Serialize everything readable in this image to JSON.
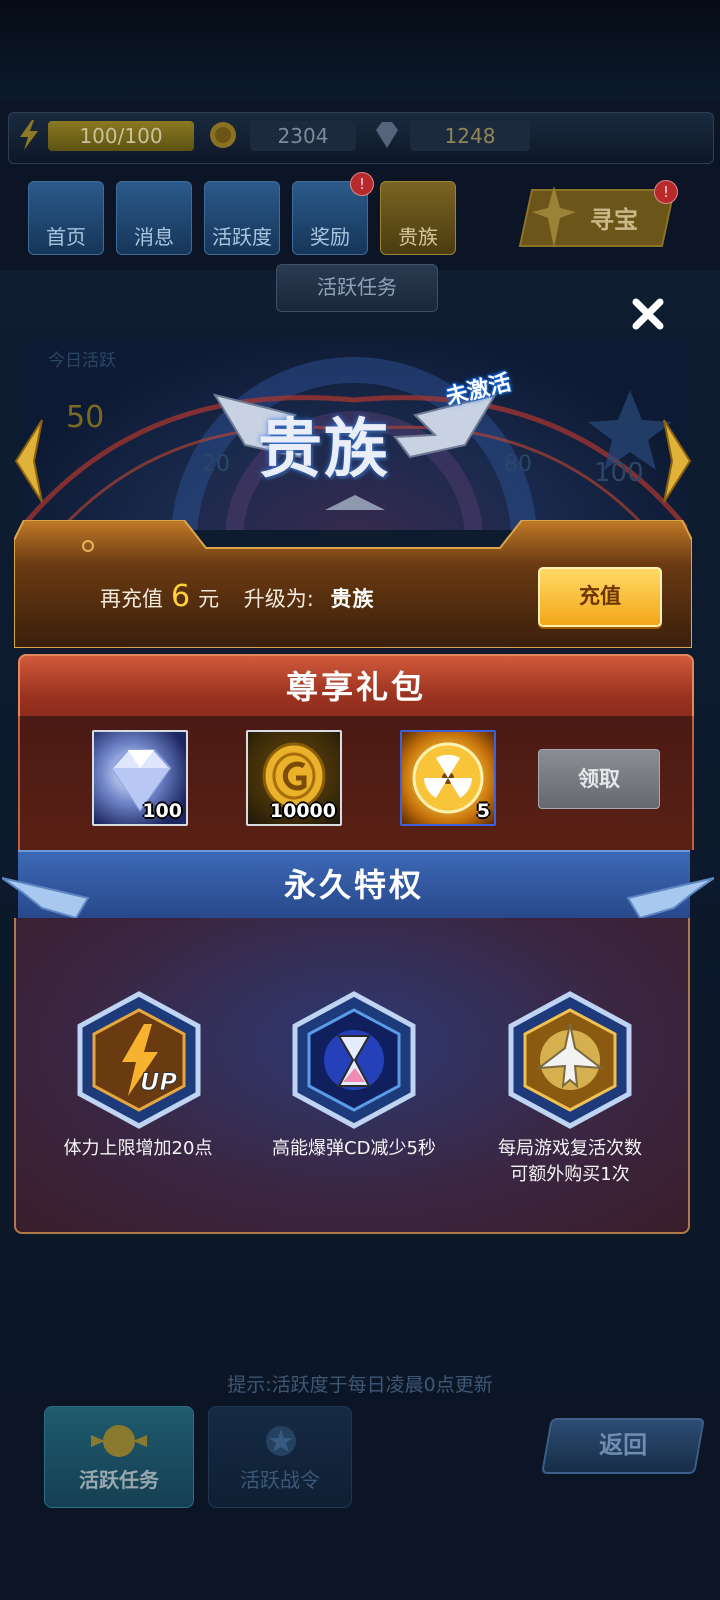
{
  "resources": {
    "energy": "100/100",
    "coins": "2304",
    "gems": "1248"
  },
  "nav": [
    {
      "label": "首页"
    },
    {
      "label": "消息"
    },
    {
      "label": "活跃度"
    },
    {
      "label": "奖励",
      "badge": "!"
    },
    {
      "label": "贵族"
    }
  ],
  "treasure": {
    "label": "寻宝",
    "badge": "!"
  },
  "frame_tab": "活跃任务",
  "background_panel": {
    "today_activity": "今日活跃",
    "activity_value": "50",
    "milestones": [
      "20",
      "80",
      "100"
    ]
  },
  "banner": {
    "title": "贵族",
    "status": "未激活"
  },
  "recharge": {
    "prefix": "再充值",
    "amount": "6",
    "unit": "元",
    "upgrade_label": "升级为:",
    "tier": "贵族",
    "button": "充值"
  },
  "gift_pack": {
    "title": "尊享礼包",
    "items": [
      {
        "icon": "diamond-icon",
        "count": "100"
      },
      {
        "icon": "gold-coin-icon",
        "count": "10000"
      },
      {
        "icon": "nuclear-bomb-icon",
        "count": "5"
      }
    ],
    "claim_button": "领取"
  },
  "privileges": {
    "title": "永久特权",
    "items": [
      {
        "icon": "energy-up-icon",
        "label_lines": [
          "体力上限增加20点"
        ]
      },
      {
        "icon": "hourglass-icon",
        "label_lines": [
          "高能爆弹CD减少5秒"
        ]
      },
      {
        "icon": "fighter-jet-icon",
        "label_lines": [
          "每局游戏复活次数",
          "可额外购买1次"
        ]
      }
    ]
  },
  "tip": "提示:活跃度于每日凌晨0点更新",
  "bottom_tabs": [
    {
      "label": "活跃任务"
    },
    {
      "label": "活跃战令"
    }
  ],
  "back_button": "返回",
  "colors": {
    "accent_gold": "#ffd23b",
    "gift_red": "#b4402a",
    "privilege_blue": "#3c69b6",
    "badge_red": "#b8292b"
  }
}
